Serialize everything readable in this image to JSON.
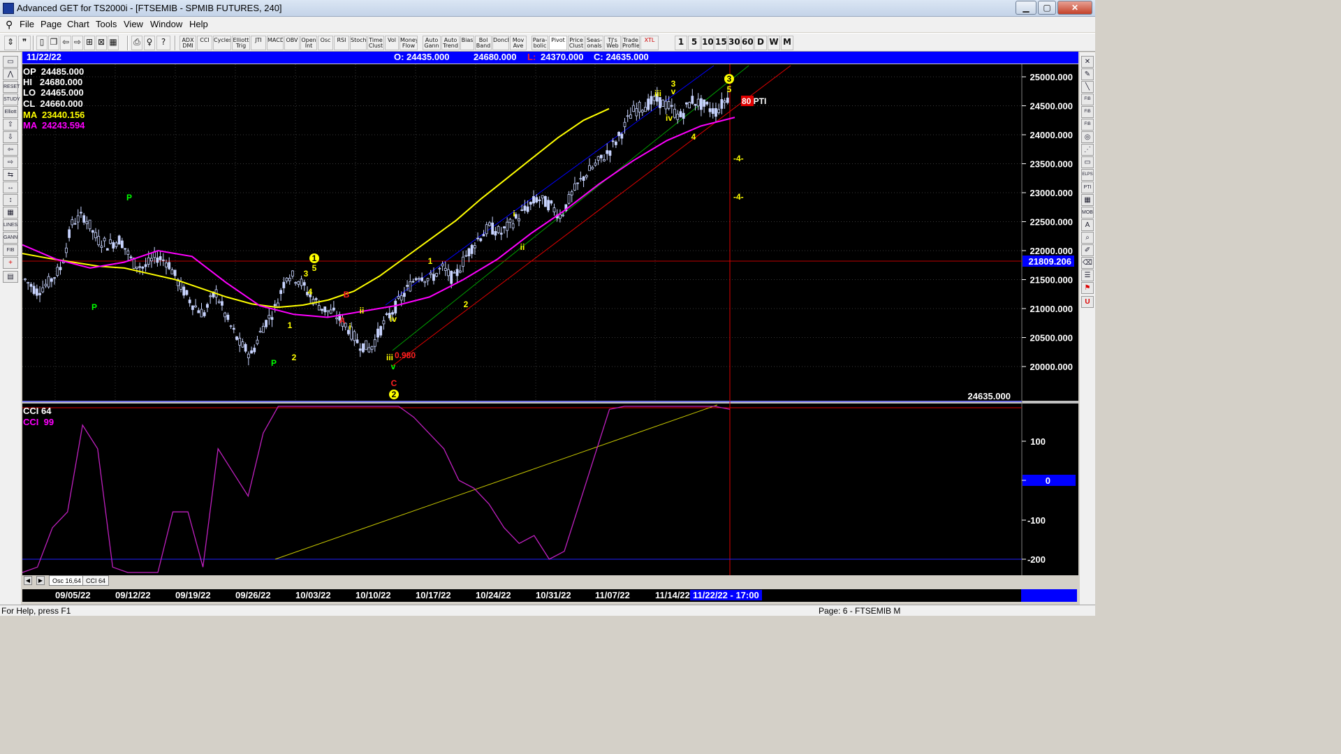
{
  "window": {
    "title": "Advanced GET for TS2000i - [FTSEMIB - SPMIB FUTURES, 240]",
    "min_glyph": "▁",
    "max_glyph": "▢",
    "close_glyph": "✕"
  },
  "menu": [
    "File",
    "Page",
    "Chart",
    "Tools",
    "View",
    "Window",
    "Help"
  ],
  "toolbar": {
    "buttons": [
      "ADX DMI",
      "CCI",
      "Cycles",
      "Elliott Trig",
      "JTI",
      "MACD",
      "OBV",
      "Open Int",
      "Osc",
      "RSI",
      "Stoch",
      "Time Clust",
      "Vol",
      "Money Flow",
      "Auto Gann",
      "Auto Trend",
      "Bias",
      "Bol Band",
      "Donch",
      "Mov Ave",
      "Para- bolic",
      "Pivot",
      "Price Clust",
      "Seas- onals",
      "TJ's Web",
      "Trade Profile",
      "XTL"
    ],
    "periods": [
      "1",
      "5",
      "10",
      "15",
      "30",
      "60",
      "D",
      "W",
      "M"
    ]
  },
  "infobar": {
    "date": "11/22/22",
    "open": "O: 24435.000",
    "high": "24680.000",
    "low_label": "L:",
    "low": "24370.000",
    "close": "C: 24635.000"
  },
  "legend": {
    "op": "OP  24485.000",
    "hi": "HI   24680.000",
    "lo": "LO  24465.000",
    "cl": "CL  24660.000",
    "ma1": "MA  23440.156",
    "ma2": "MA  24243.594",
    "cci1": "CCI 64",
    "cci2": "CCI  99"
  },
  "price_axis": {
    "ticks": [
      "25000.000",
      "24500.000",
      "24000.000",
      "23500.000",
      "23000.000",
      "22500.000",
      "22000.000",
      "21500.000",
      "21000.000",
      "20500.000",
      "20000.000"
    ],
    "cursor_price": "21809.206",
    "last_price": "24635.000"
  },
  "cci_axis": {
    "ticks": [
      "100",
      "0",
      "-100",
      "-200"
    ]
  },
  "annotations": {
    "pti": "80 PTI",
    "ratio": "0.980",
    "target_1": "-4-",
    "target_2": "-4-"
  },
  "wave_labels": [
    "P",
    "P",
    "P",
    "1",
    "2",
    "3",
    "4",
    "5",
    "1",
    "A",
    "B",
    "i",
    "ii",
    "iii",
    "iv",
    "v",
    "C",
    "2",
    "1",
    "2",
    "i",
    "ii",
    "iii",
    "iv",
    "3",
    "v",
    "4",
    "5",
    "3"
  ],
  "date_axis": [
    "09/05/22",
    "09/12/22",
    "09/19/22",
    "09/26/22",
    "10/03/22",
    "10/10/22",
    "10/17/22",
    "10/24/22",
    "10/31/22",
    "11/07/22",
    "11/14/22"
  ],
  "cursor_date": "11/22/22 - 17:00",
  "tabs": [
    "Osc 16,64",
    "CCI 64"
  ],
  "status": {
    "left": "For Help, press F1",
    "right": "Page: 6 - FTSEMIB M"
  },
  "colors": {
    "background": "#000000",
    "ma_fast": "#ffff00",
    "ma_slow": "#ff00ff",
    "cci": "#c020c0",
    "channel_blue": "#0000ff",
    "channel_green": "#00a000",
    "channel_red": "#e00000",
    "cursor_line": "#e00000",
    "candles": "#c8d4ff"
  },
  "chart_data": {
    "type": "candlestick",
    "symbol": "FTSEMIB - SPMIB FUTURES",
    "ylim": [
      19700,
      25250
    ],
    "x": [
      "09/05/22",
      "09/12/22",
      "09/19/22",
      "09/26/22",
      "10/03/22",
      "10/10/22",
      "10/17/22",
      "10/24/22",
      "10/31/22",
      "11/07/22",
      "11/14/22",
      "11/22/22"
    ],
    "close_path": [
      21500,
      21300,
      21450,
      21700,
      22500,
      22600,
      22200,
      22100,
      22200,
      21800,
      21700,
      21900,
      21800,
      21400,
      21100,
      20900,
      21300,
      20800,
      20400,
      20200,
      20700,
      21000,
      21600,
      21500,
      21200,
      21000,
      20900,
      20700,
      20400,
      20300,
      20700,
      21000,
      21300,
      21600,
      21500,
      21700,
      21500,
      21900,
      22200,
      22400,
      22300,
      22500,
      22700,
      22900,
      22800,
      22600,
      23000,
      23300,
      23500,
      23700,
      24000,
      24400,
      24500,
      24600,
      24500,
      24300,
      24600,
      24500,
      24400,
      24635
    ],
    "ma_fast": [
      21950,
      21870,
      21800,
      21730,
      21700,
      21600,
      21500,
      21350,
      21200,
      21080,
      21020,
      21060,
      21150,
      21300,
      21560,
      21880,
      22200,
      22520,
      22900,
      23250,
      23600,
      23950,
      24250,
      24450
    ],
    "ma_slow": [
      22100,
      21850,
      21700,
      21800,
      22000,
      21900,
      21450,
      21050,
      20900,
      20850,
      20950,
      21050,
      21200,
      21500,
      21850,
      22300,
      22700,
      23150,
      23550,
      23900,
      24150,
      24300
    ],
    "cci_series": [
      -210,
      -110,
      -60,
      -40,
      70,
      40,
      -110,
      -140,
      -180,
      -120,
      -40,
      -40,
      -110,
      40,
      10,
      -20,
      60,
      130,
      170,
      190,
      160,
      150,
      140,
      160,
      130,
      120,
      80,
      60,
      40,
      0,
      -10,
      -30,
      -60,
      -80,
      -70,
      -100,
      -90,
      -30,
      30,
      90,
      140,
      180,
      150,
      160,
      150,
      130,
      110,
      90
    ]
  }
}
